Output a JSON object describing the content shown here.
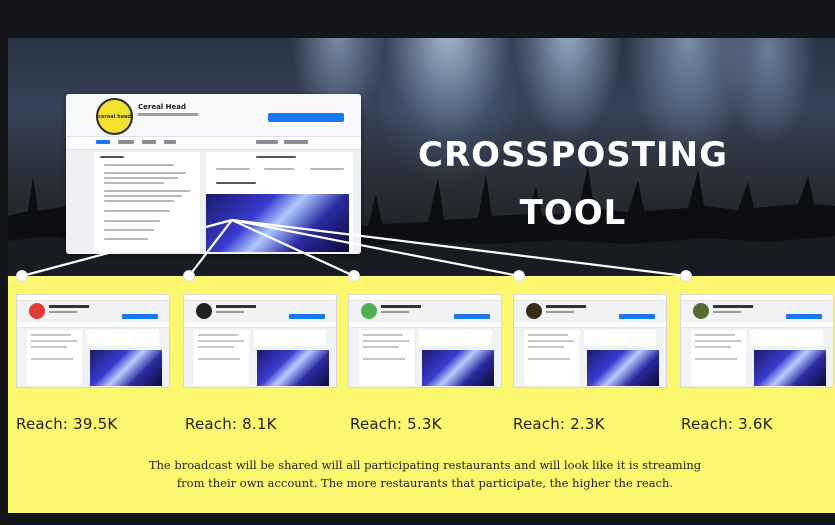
{
  "title_line1": "CROSSPOSTING",
  "title_line2": "TOOL",
  "main_page": {
    "name": "Cereal Head",
    "logo_text": "cereal head"
  },
  "thumbnails": [
    {
      "reach": "Reach: 39.5K",
      "logo_color": "#e53935"
    },
    {
      "reach": "Reach: 8.1K",
      "logo_color": "#222222"
    },
    {
      "reach": "Reach: 5.3K",
      "logo_color": "#4caf50"
    },
    {
      "reach": "Reach: 2.3K",
      "logo_color": "#3a2a1a"
    },
    {
      "reach": "Reach: 3.6K",
      "logo_color": "#556b2f"
    }
  ],
  "caption_line1": "The broadcast will be shared will all participating restaurants and will look like it is streaming",
  "caption_line2": "from their own account. The more restaurants that participate, the higher the reach.",
  "colors": {
    "band": "#fbf76e",
    "background": "#141619",
    "facebook_blue": "#1877f2"
  }
}
